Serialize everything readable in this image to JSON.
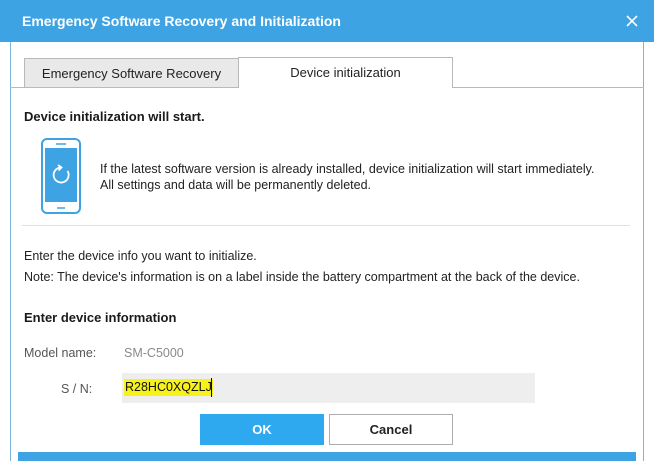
{
  "window": {
    "title": "Emergency Software Recovery and Initialization"
  },
  "tabs": [
    {
      "label": "Emergency Software Recovery",
      "active": false
    },
    {
      "label": "Device initialization",
      "active": true
    }
  ],
  "content": {
    "heading": "Device initialization will start.",
    "info_line1": "If the latest software version is already installed, device initialization will start immediately.",
    "info_line2": "All settings and data will be permanently deleted.",
    "instruction": "Enter the device info you want to initialize.",
    "note": "Note: The device's information is on a label inside the battery compartment at the back of the device.",
    "device_info_heading": "Enter device information",
    "model_label": "Model name:",
    "model_value": "SM-C5000",
    "sn_label": "S / N:",
    "sn_value": "R28HC0XQZLJ"
  },
  "buttons": {
    "ok": "OK",
    "cancel": "Cancel"
  },
  "colors": {
    "title_bar": "#3ea3e2",
    "primary_button": "#2ea8ef",
    "highlight": "#f8f21b"
  },
  "icons": {
    "close": "close-icon",
    "phone": "phone-refresh-icon"
  }
}
